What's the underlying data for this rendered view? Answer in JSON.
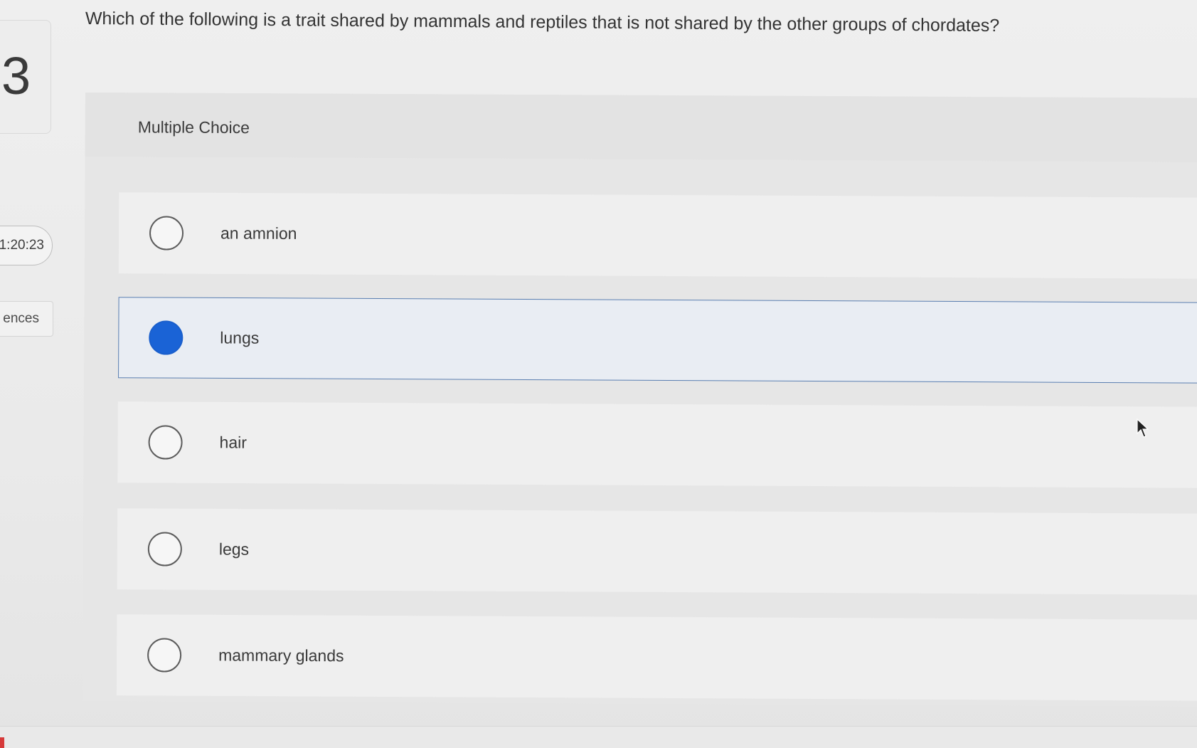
{
  "question": {
    "number": "3",
    "text": "Which of the following is a trait shared by mammals and reptiles that is not shared by the other groups of chordates?"
  },
  "sidebar": {
    "timer": "1:20:23",
    "references_label": "ences"
  },
  "multiple_choice": {
    "label": "Multiple Choice",
    "choices": [
      {
        "text": "an amnion",
        "selected": false
      },
      {
        "text": "lungs",
        "selected": true
      },
      {
        "text": "hair",
        "selected": false
      },
      {
        "text": "legs",
        "selected": false
      },
      {
        "text": "mammary glands",
        "selected": false
      }
    ]
  },
  "colors": {
    "selected_radio": "#1a63d6",
    "selected_border": "#5a7eb0"
  }
}
